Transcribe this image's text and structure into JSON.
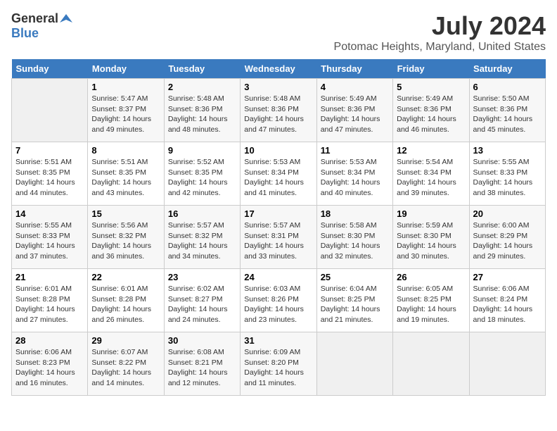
{
  "logo": {
    "general": "General",
    "blue": "Blue"
  },
  "title": "July 2024",
  "location": "Potomac Heights, Maryland, United States",
  "weekdays": [
    "Sunday",
    "Monday",
    "Tuesday",
    "Wednesday",
    "Thursday",
    "Friday",
    "Saturday"
  ],
  "weeks": [
    [
      {
        "day": "",
        "info": ""
      },
      {
        "day": "1",
        "info": "Sunrise: 5:47 AM\nSunset: 8:37 PM\nDaylight: 14 hours\nand 49 minutes."
      },
      {
        "day": "2",
        "info": "Sunrise: 5:48 AM\nSunset: 8:36 PM\nDaylight: 14 hours\nand 48 minutes."
      },
      {
        "day": "3",
        "info": "Sunrise: 5:48 AM\nSunset: 8:36 PM\nDaylight: 14 hours\nand 47 minutes."
      },
      {
        "day": "4",
        "info": "Sunrise: 5:49 AM\nSunset: 8:36 PM\nDaylight: 14 hours\nand 47 minutes."
      },
      {
        "day": "5",
        "info": "Sunrise: 5:49 AM\nSunset: 8:36 PM\nDaylight: 14 hours\nand 46 minutes."
      },
      {
        "day": "6",
        "info": "Sunrise: 5:50 AM\nSunset: 8:36 PM\nDaylight: 14 hours\nand 45 minutes."
      }
    ],
    [
      {
        "day": "7",
        "info": "Sunrise: 5:51 AM\nSunset: 8:35 PM\nDaylight: 14 hours\nand 44 minutes."
      },
      {
        "day": "8",
        "info": "Sunrise: 5:51 AM\nSunset: 8:35 PM\nDaylight: 14 hours\nand 43 minutes."
      },
      {
        "day": "9",
        "info": "Sunrise: 5:52 AM\nSunset: 8:35 PM\nDaylight: 14 hours\nand 42 minutes."
      },
      {
        "day": "10",
        "info": "Sunrise: 5:53 AM\nSunset: 8:34 PM\nDaylight: 14 hours\nand 41 minutes."
      },
      {
        "day": "11",
        "info": "Sunrise: 5:53 AM\nSunset: 8:34 PM\nDaylight: 14 hours\nand 40 minutes."
      },
      {
        "day": "12",
        "info": "Sunrise: 5:54 AM\nSunset: 8:34 PM\nDaylight: 14 hours\nand 39 minutes."
      },
      {
        "day": "13",
        "info": "Sunrise: 5:55 AM\nSunset: 8:33 PM\nDaylight: 14 hours\nand 38 minutes."
      }
    ],
    [
      {
        "day": "14",
        "info": "Sunrise: 5:55 AM\nSunset: 8:33 PM\nDaylight: 14 hours\nand 37 minutes."
      },
      {
        "day": "15",
        "info": "Sunrise: 5:56 AM\nSunset: 8:32 PM\nDaylight: 14 hours\nand 36 minutes."
      },
      {
        "day": "16",
        "info": "Sunrise: 5:57 AM\nSunset: 8:32 PM\nDaylight: 14 hours\nand 34 minutes."
      },
      {
        "day": "17",
        "info": "Sunrise: 5:57 AM\nSunset: 8:31 PM\nDaylight: 14 hours\nand 33 minutes."
      },
      {
        "day": "18",
        "info": "Sunrise: 5:58 AM\nSunset: 8:30 PM\nDaylight: 14 hours\nand 32 minutes."
      },
      {
        "day": "19",
        "info": "Sunrise: 5:59 AM\nSunset: 8:30 PM\nDaylight: 14 hours\nand 30 minutes."
      },
      {
        "day": "20",
        "info": "Sunrise: 6:00 AM\nSunset: 8:29 PM\nDaylight: 14 hours\nand 29 minutes."
      }
    ],
    [
      {
        "day": "21",
        "info": "Sunrise: 6:01 AM\nSunset: 8:28 PM\nDaylight: 14 hours\nand 27 minutes."
      },
      {
        "day": "22",
        "info": "Sunrise: 6:01 AM\nSunset: 8:28 PM\nDaylight: 14 hours\nand 26 minutes."
      },
      {
        "day": "23",
        "info": "Sunrise: 6:02 AM\nSunset: 8:27 PM\nDaylight: 14 hours\nand 24 minutes."
      },
      {
        "day": "24",
        "info": "Sunrise: 6:03 AM\nSunset: 8:26 PM\nDaylight: 14 hours\nand 23 minutes."
      },
      {
        "day": "25",
        "info": "Sunrise: 6:04 AM\nSunset: 8:25 PM\nDaylight: 14 hours\nand 21 minutes."
      },
      {
        "day": "26",
        "info": "Sunrise: 6:05 AM\nSunset: 8:25 PM\nDaylight: 14 hours\nand 19 minutes."
      },
      {
        "day": "27",
        "info": "Sunrise: 6:06 AM\nSunset: 8:24 PM\nDaylight: 14 hours\nand 18 minutes."
      }
    ],
    [
      {
        "day": "28",
        "info": "Sunrise: 6:06 AM\nSunset: 8:23 PM\nDaylight: 14 hours\nand 16 minutes."
      },
      {
        "day": "29",
        "info": "Sunrise: 6:07 AM\nSunset: 8:22 PM\nDaylight: 14 hours\nand 14 minutes."
      },
      {
        "day": "30",
        "info": "Sunrise: 6:08 AM\nSunset: 8:21 PM\nDaylight: 14 hours\nand 12 minutes."
      },
      {
        "day": "31",
        "info": "Sunrise: 6:09 AM\nSunset: 8:20 PM\nDaylight: 14 hours\nand 11 minutes."
      },
      {
        "day": "",
        "info": ""
      },
      {
        "day": "",
        "info": ""
      },
      {
        "day": "",
        "info": ""
      }
    ]
  ]
}
